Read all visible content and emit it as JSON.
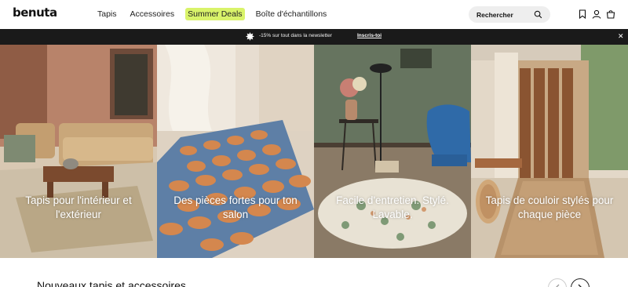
{
  "header": {
    "logo": "benuta",
    "nav": [
      "Tapis",
      "Accessoires",
      "Summer Deals",
      "Boîte d'échantillons"
    ],
    "search_label": "Rechercher"
  },
  "promo": {
    "text": "-15% sur tout dans la newsletter",
    "link": "Inscris-toi"
  },
  "tiles": [
    {
      "caption": "Tapis pour l'intérieur et l'extérieur"
    },
    {
      "caption": "Des pièces fortes pour ton salon"
    },
    {
      "caption": "Facile d'entretien. Stylé. Lavable."
    },
    {
      "caption": "Tapis de couloir stylés pour chaque pièce"
    }
  ],
  "section": {
    "title": "Nouveaux tapis et accessoires"
  },
  "colors": {
    "deal_highlight": "#d9f36a",
    "promo_bg": "#1a1a1a"
  }
}
